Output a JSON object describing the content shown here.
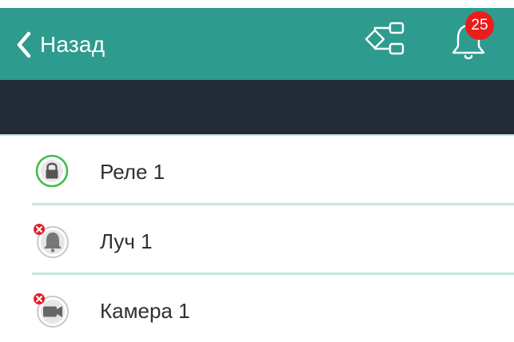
{
  "navbar": {
    "back_label": "Назад",
    "notification_count": "25",
    "colors": {
      "navbar_bg": "#2e9b8f",
      "dark_band": "#212b35",
      "badge_bg": "#ee1b1b",
      "divider": "#c3e6e2"
    },
    "icons": {
      "back": "chevron-left-icon",
      "tree": "object-tree-icon",
      "bell": "bell-icon"
    }
  },
  "list": {
    "items": [
      {
        "label": "Реле 1",
        "icon": "lock-icon",
        "status": "ok",
        "status_color": "#3fbf4a"
      },
      {
        "label": "Луч 1",
        "icon": "bell-icon",
        "status": "error",
        "status_color": "#e0202a"
      },
      {
        "label": "Камера 1",
        "icon": "camera-icon",
        "status": "error",
        "status_color": "#e0202a"
      }
    ]
  }
}
